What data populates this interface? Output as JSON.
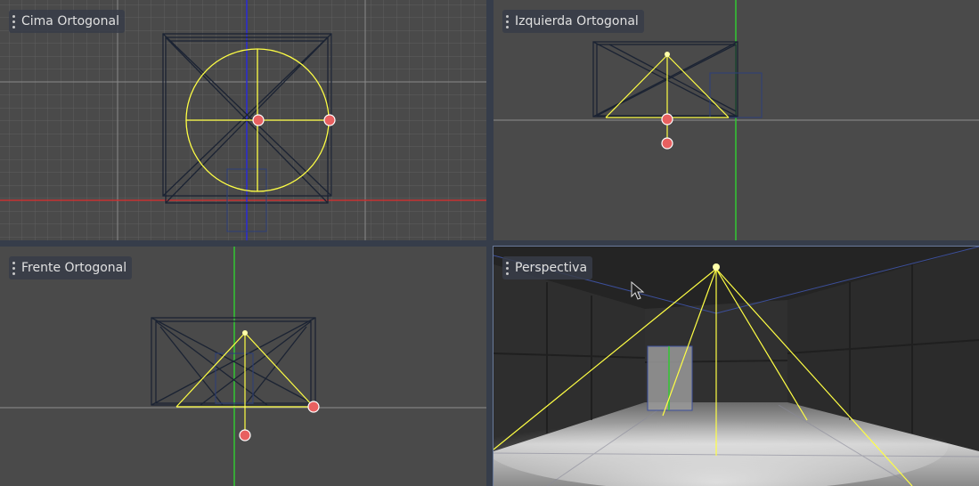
{
  "viewports": {
    "top": {
      "label": "Cima Ortogonal"
    },
    "left": {
      "label": "Izquierda Ortogonal"
    },
    "front": {
      "label": "Frente Ortogonal"
    },
    "persp": {
      "label": "Perspectiva"
    }
  },
  "colors": {
    "background": "#4b4b4b",
    "grid": "#6a6a6a",
    "axis_x": "#c83232",
    "axis_y": "#32c832",
    "axis_z": "#2a2ad8",
    "light_gizmo": "#ffff44",
    "handle": "#e86060",
    "wireframe": "#1b2333",
    "separator": "#363d4a"
  },
  "icons": {
    "viewport_menu": "vertical-dots-icon",
    "light_handle": "circle-handle-icon",
    "mouse_cursor": "arrow-cursor-icon"
  }
}
